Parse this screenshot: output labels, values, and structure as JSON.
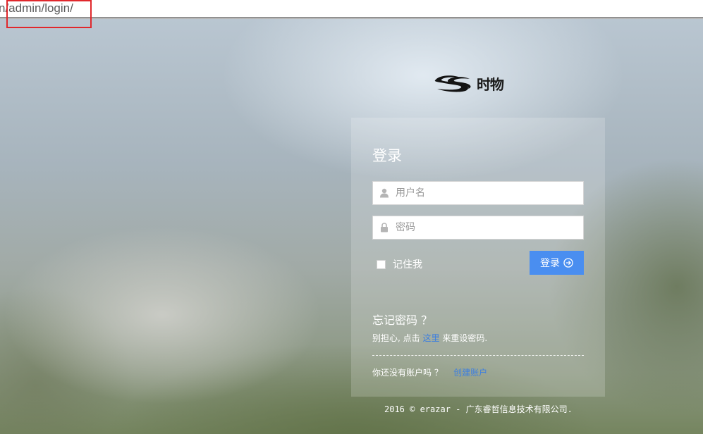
{
  "browser": {
    "url_fragment": "n/admin/login/"
  },
  "logo": {
    "text": "时物",
    "icon": "ss-swoosh-logo"
  },
  "login": {
    "title": "登录",
    "username_placeholder": "用户名",
    "password_placeholder": "密码",
    "username_icon": "user-icon",
    "password_icon": "lock-icon",
    "remember_label": "记住我",
    "remember_checked": false,
    "submit_label": "登录",
    "submit_icon": "circle-arrow-right-icon",
    "accent_color": "#4a8ef0"
  },
  "forgot": {
    "title": "忘记密码 ？",
    "text_before": "别担心, 点击",
    "link": "这里",
    "text_after": "来重设密码."
  },
  "register": {
    "text": "你还没有账户吗 ？",
    "link": "创建账户"
  },
  "footer": {
    "copyright": "2016 © erazar - 广东睿哲信息技术有限公司."
  }
}
